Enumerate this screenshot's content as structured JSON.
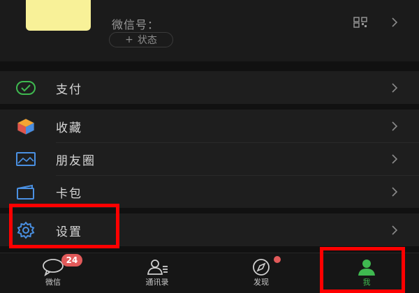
{
  "profile": {
    "wechat_id_label": "微信号：",
    "status_label": "状态",
    "status_plus": "+"
  },
  "menu": {
    "pay": "支付",
    "favorites": "收藏",
    "moments": "朋友圈",
    "cards": "卡包",
    "settings": "设置"
  },
  "tabbar": {
    "chats": "微信",
    "chats_badge": "24",
    "contacts": "通讯录",
    "discover": "发现",
    "me": "我"
  },
  "colors": {
    "background": "#191919",
    "accent_green": "#3fb950",
    "badge_red": "#e25a5a",
    "highlight_red": "#ff0000"
  }
}
